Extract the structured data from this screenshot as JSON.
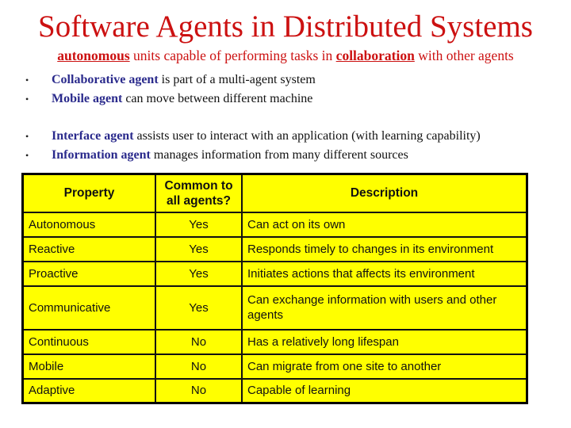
{
  "title": "Software Agents in Distributed Systems",
  "subtitle": {
    "parts": [
      {
        "text": "autonomous",
        "underline": true
      },
      {
        "text": " units capable of performing tasks in ",
        "underline": false
      },
      {
        "text": "collaboration",
        "underline": true
      },
      {
        "text": " with other agents",
        "underline": false
      }
    ]
  },
  "bullets_group_1": [
    {
      "key": "Collaborative agent",
      "rest": " is part of a multi-agent system"
    },
    {
      "key": "Mobile agent",
      "rest": " can move between different machine"
    }
  ],
  "bullets_group_2": [
    {
      "key": "Interface agent",
      "rest": " assists user to interact with an application (with learning capability)"
    },
    {
      "key": "Information agent",
      "rest": " manages information from many different sources"
    }
  ],
  "bullet_glyph": "•",
  "colors": {
    "title": "#cc1111",
    "key_term": "#2a2a8c",
    "table_fill": "#ffff00"
  },
  "table": {
    "headers": [
      "Property",
      "Common to all agents?",
      "Description"
    ],
    "rows": [
      [
        "Autonomous",
        "Yes",
        "Can act on its own"
      ],
      [
        "Reactive",
        "Yes",
        "Responds timely to changes in its environment"
      ],
      [
        "Proactive",
        "Yes",
        "Initiates actions that affects its environment"
      ],
      [
        "Communicative",
        "Yes",
        "Can exchange information with users and other agents"
      ],
      [
        "Continuous",
        "No",
        "Has a relatively long lifespan"
      ],
      [
        "Mobile",
        "No",
        "Can migrate from one site to another"
      ],
      [
        "Adaptive",
        "No",
        "Capable of learning"
      ]
    ]
  }
}
